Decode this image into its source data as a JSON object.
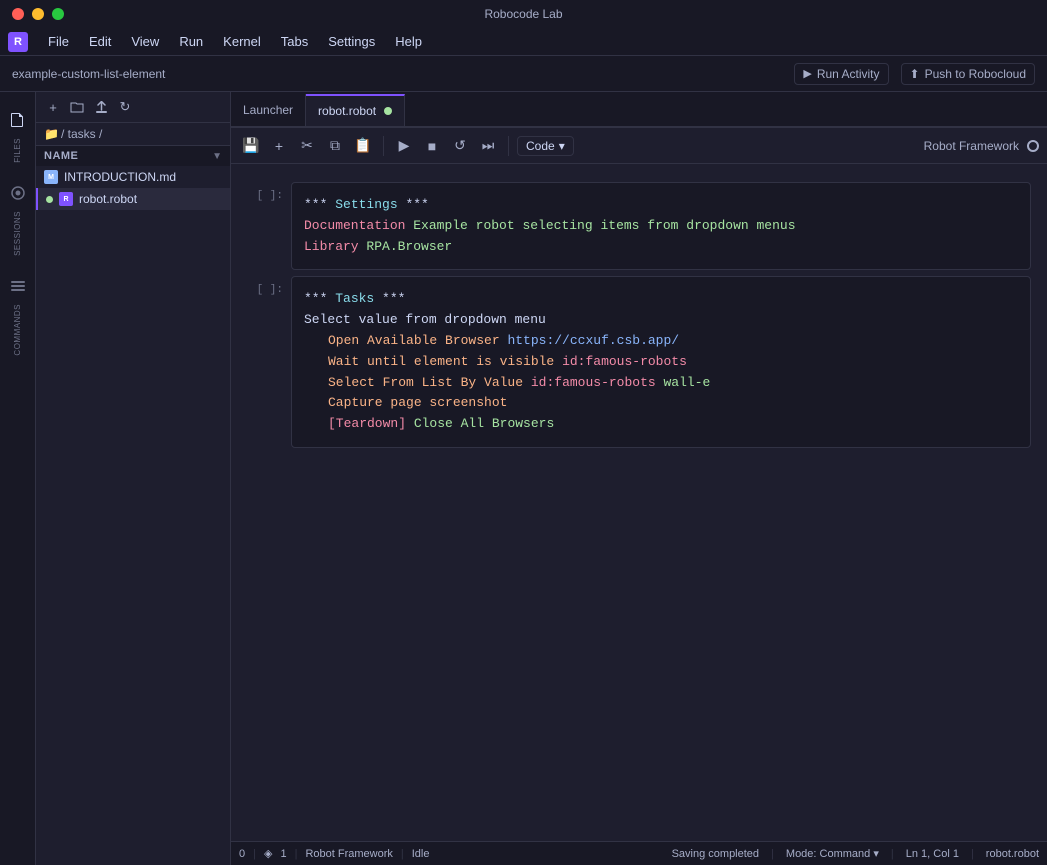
{
  "titlebar": {
    "title": "Robocode Lab"
  },
  "menubar": {
    "items": [
      "File",
      "Edit",
      "View",
      "Run",
      "Kernel",
      "Tabs",
      "Settings",
      "Help"
    ]
  },
  "projectbar": {
    "name": "example-custom-list-element",
    "run_activity": "Run Activity",
    "push_btn": "Push to Robocloud"
  },
  "icon_sidebar": {
    "files_label": "Files",
    "sessions_label": "Sessions",
    "commands_label": "Commands"
  },
  "file_sidebar": {
    "breadcrumb": "/ tasks /",
    "header_name": "Name",
    "files": [
      {
        "name": "INTRODUCTION.md",
        "type": "md",
        "active": false,
        "modified": false
      },
      {
        "name": "robot.robot",
        "type": "robot",
        "active": true,
        "modified": false
      }
    ]
  },
  "tabs": [
    {
      "label": "Launcher",
      "active": false,
      "modified": false
    },
    {
      "label": "robot.robot",
      "active": true,
      "modified": true
    }
  ],
  "notebook_toolbar": {
    "kernel_label": "Robot Framework",
    "code_select": "Code"
  },
  "cells": [
    {
      "gutter": "[ ]:",
      "content_lines": [
        {
          "type": "section",
          "text": "*** Settings ***"
        },
        {
          "type": "doclib",
          "key": "Documentation",
          "value": "Example robot selecting items from dropdown menus"
        },
        {
          "type": "doclib",
          "key": "Library",
          "value": "RPA.Browser"
        }
      ]
    },
    {
      "gutter": "[ ]:",
      "content_lines": [
        {
          "type": "section",
          "text": "*** Tasks ***"
        },
        {
          "type": "plain",
          "text": "Select value from dropdown menu"
        },
        {
          "type": "keyword_url",
          "keyword": "Open Available Browser",
          "url": "https://ccxuf.csb.app/"
        },
        {
          "type": "keyword_id",
          "keyword": "Wait until element is visible",
          "id": "id:famous-robots"
        },
        {
          "type": "keyword_id_val",
          "keyword": "Select From List By Value",
          "id": "id:famous-robots",
          "val": "wall-e"
        },
        {
          "type": "keyword_plain",
          "keyword": "Capture page screenshot"
        },
        {
          "type": "teardown",
          "text": "[Teardown]",
          "value": "Close All Browsers"
        }
      ]
    }
  ],
  "statusbar": {
    "number": "0",
    "kernel_count": "1",
    "kernel_label": "Robot Framework",
    "idle_label": "Idle",
    "saving": "Saving completed",
    "mode": "Mode: Command",
    "position": "Ln 1, Col 1",
    "file": "robot.robot"
  }
}
